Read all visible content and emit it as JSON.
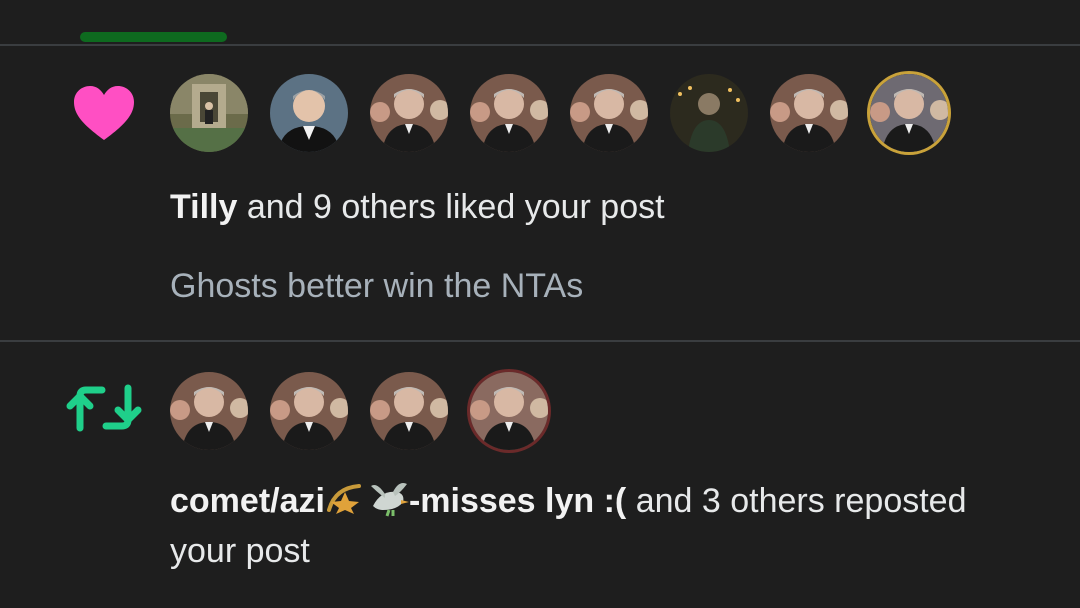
{
  "tabs": {
    "active_indicator_color": "#0e6a1f"
  },
  "like_notification": {
    "icon": "heart-icon",
    "icon_color": "#ff4fc3",
    "avatars": [
      {
        "name": "avatar-1"
      },
      {
        "name": "avatar-2"
      },
      {
        "name": "avatar-3"
      },
      {
        "name": "avatar-4"
      },
      {
        "name": "avatar-5"
      },
      {
        "name": "avatar-6"
      },
      {
        "name": "avatar-7"
      },
      {
        "name": "avatar-8"
      }
    ],
    "actor_name": "Tilly",
    "summary_rest": " and 9 others liked your post",
    "post_snippet": "Ghosts better win the NTAs"
  },
  "repost_notification": {
    "icon": "repost-icon",
    "icon_color": "#1fcf8a",
    "avatars": [
      {
        "name": "avatar-1"
      },
      {
        "name": "avatar-2"
      },
      {
        "name": "avatar-3"
      },
      {
        "name": "avatar-4"
      }
    ],
    "actor_name_prefix": "comet/azi",
    "actor_name_suffix": "-misses lyn :(",
    "actor_emojis": [
      "shooting-star-emoji",
      "dove-emoji"
    ],
    "summary_rest": " and 3 others reposted your post"
  }
}
